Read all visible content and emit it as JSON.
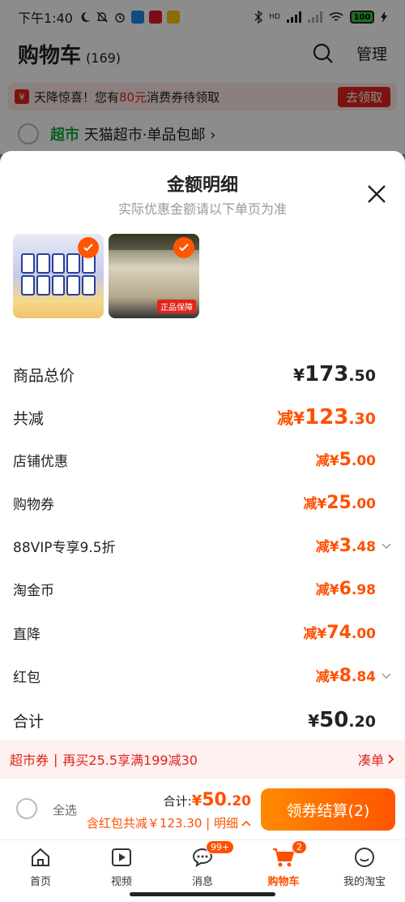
{
  "status_bar": {
    "time": "下午1:40",
    "battery": "100",
    "hd": "HD"
  },
  "header": {
    "title": "购物车",
    "count": "(169)",
    "manage": "管理"
  },
  "banner": {
    "text_prefix": "天降惊喜！您有",
    "amount": "80元",
    "text_suffix": "消费券待领取",
    "claim": "去领取"
  },
  "store_row": {
    "tag": "超市",
    "name": "天猫超市·单品包邮",
    "chevron": "›"
  },
  "sheet": {
    "title": "金额明细",
    "subtitle": "实际优惠金额请以下单页为准",
    "thumb1_badge": "",
    "thumb2_badge": "正品保障"
  },
  "rows": [
    {
      "label": "商品总价",
      "prefix": "¥",
      "int": "173",
      "dec": ".50"
    },
    {
      "label": "共减",
      "prefix": "减¥",
      "int": "123",
      "dec": ".30"
    },
    {
      "label": "店铺优惠",
      "prefix": "减¥",
      "int": "5",
      "dec": ".00"
    },
    {
      "label": "购物券",
      "prefix": "减¥",
      "int": "25",
      "dec": ".00"
    },
    {
      "label": "88VIP专享9.5折",
      "prefix": "减¥",
      "int": "3",
      "dec": ".48"
    },
    {
      "label": "淘金币",
      "prefix": "减¥",
      "int": "6",
      "dec": ".98"
    },
    {
      "label": "直降",
      "prefix": "减¥",
      "int": "74",
      "dec": ".00"
    },
    {
      "label": "红包",
      "prefix": "减¥",
      "int": "8",
      "dec": ".84"
    },
    {
      "label": "合计",
      "prefix": "¥",
      "int": "50",
      "dec": ".20"
    }
  ],
  "promo": {
    "tag": "超市券",
    "sep": "|",
    "text": "再买25.5享满199减30",
    "action": "凑单"
  },
  "checkout": {
    "select_all": "全选",
    "total_label": "合计:",
    "total_prefix": "¥",
    "total_int": "50",
    "total_dec": ".20",
    "detail": "含红包共减￥123.30 | 明细",
    "button": "领券结算(2)"
  },
  "tabs": [
    {
      "label": "首页"
    },
    {
      "label": "视频"
    },
    {
      "label": "消息",
      "badge": "99+"
    },
    {
      "label": "购物车",
      "badge": "2"
    },
    {
      "label": "我的淘宝"
    }
  ],
  "colors": {
    "accent": "#ff5000",
    "red": "#e1251b",
    "green": "#19a83a"
  }
}
